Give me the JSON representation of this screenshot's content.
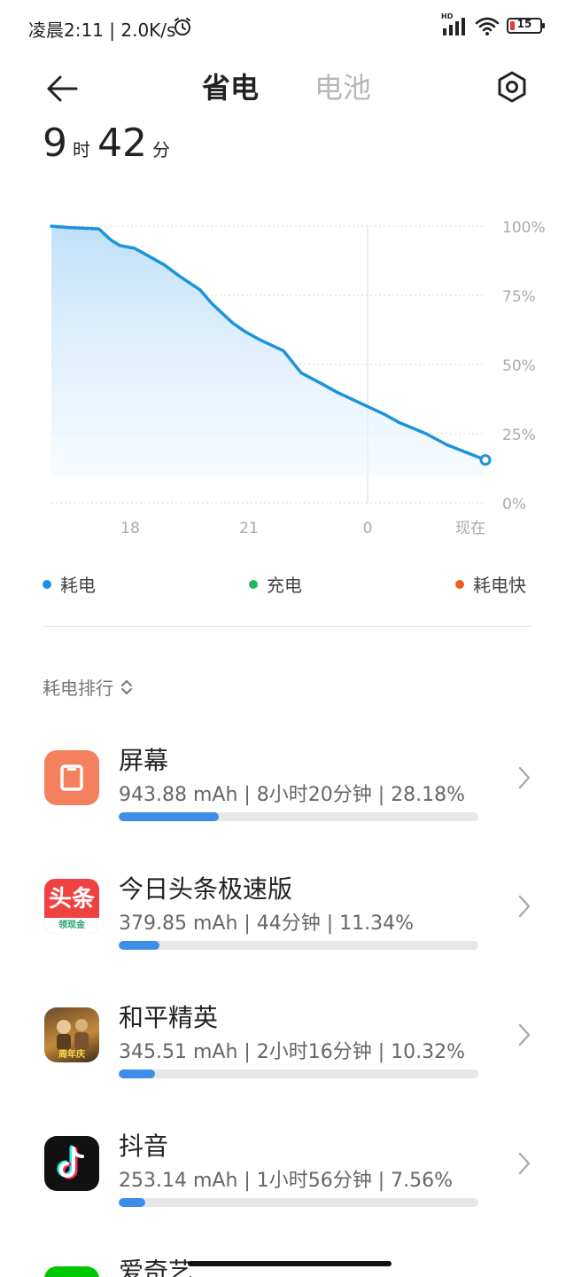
{
  "status": {
    "time_speed": "凌晨2:11 | 2.0K/s",
    "battery_level": "15",
    "hd_label": "HD"
  },
  "header": {
    "tabs": [
      {
        "label": "省电",
        "active": true
      },
      {
        "label": "电池",
        "active": false
      }
    ]
  },
  "remaining": {
    "hours": "9",
    "hours_unit": "时",
    "minutes": "42",
    "minutes_unit": "分"
  },
  "chart_data": {
    "type": "area",
    "x_ticks": [
      "18",
      "21",
      "0",
      "现在"
    ],
    "y_ticks": [
      "100%",
      "75%",
      "50%",
      "25%",
      "0%"
    ],
    "ylim": [
      0,
      100
    ],
    "series": [
      {
        "values": [
          [
            0,
            100
          ],
          [
            0.06,
            99.5
          ],
          [
            0.16,
            99
          ],
          [
            0.2,
            95
          ],
          [
            0.23,
            93
          ],
          [
            0.28,
            92
          ],
          [
            0.33,
            89
          ],
          [
            0.38,
            86
          ],
          [
            0.43,
            82
          ],
          [
            0.5,
            77
          ],
          [
            0.54,
            72
          ],
          [
            0.61,
            65
          ],
          [
            0.65,
            62
          ],
          [
            0.7,
            59
          ],
          [
            0.78,
            55
          ],
          [
            0.84,
            47
          ],
          [
            0.91,
            43
          ],
          [
            0.96,
            40
          ],
          [
            1.04,
            36
          ],
          [
            1.12,
            32
          ],
          [
            1.17,
            29
          ],
          [
            1.26,
            25
          ],
          [
            1.33,
            21
          ],
          [
            1.4,
            18
          ],
          [
            1.46,
            15.5
          ]
        ]
      }
    ],
    "legend": [
      {
        "label": "耗电",
        "color": "#1e8ee6"
      },
      {
        "label": "充电",
        "color": "#22b85a"
      },
      {
        "label": "耗电快",
        "color": "#e8601f"
      }
    ],
    "colors": {
      "line": "#1b94dc",
      "fill": "#cfe8fb"
    }
  },
  "ranking": {
    "title": "耗电排行",
    "apps": [
      {
        "name": "屏幕",
        "stat": "943.88 mAh | 8小时20分钟 | 28.18%",
        "percent": 28.18,
        "icon": "screen-icon"
      },
      {
        "name": "今日头条极速版",
        "stat": "379.85 mAh | 44分钟 | 11.34%",
        "percent": 11.34,
        "icon": "toutiao-icon",
        "icon_text": "头条",
        "icon_subtext": "领现金"
      },
      {
        "name": "和平精英",
        "stat": "345.51 mAh | 2小时16分钟 | 10.32%",
        "percent": 10.32,
        "icon": "peacekeeper-elite-icon",
        "icon_text": "周年庆"
      },
      {
        "name": "抖音",
        "stat": "253.14 mAh | 1小时56分钟 | 7.56%",
        "percent": 7.56,
        "icon": "douyin-icon"
      },
      {
        "name": "爱奇艺",
        "stat": "",
        "percent": 0,
        "icon": "iqiyi-icon"
      }
    ]
  }
}
